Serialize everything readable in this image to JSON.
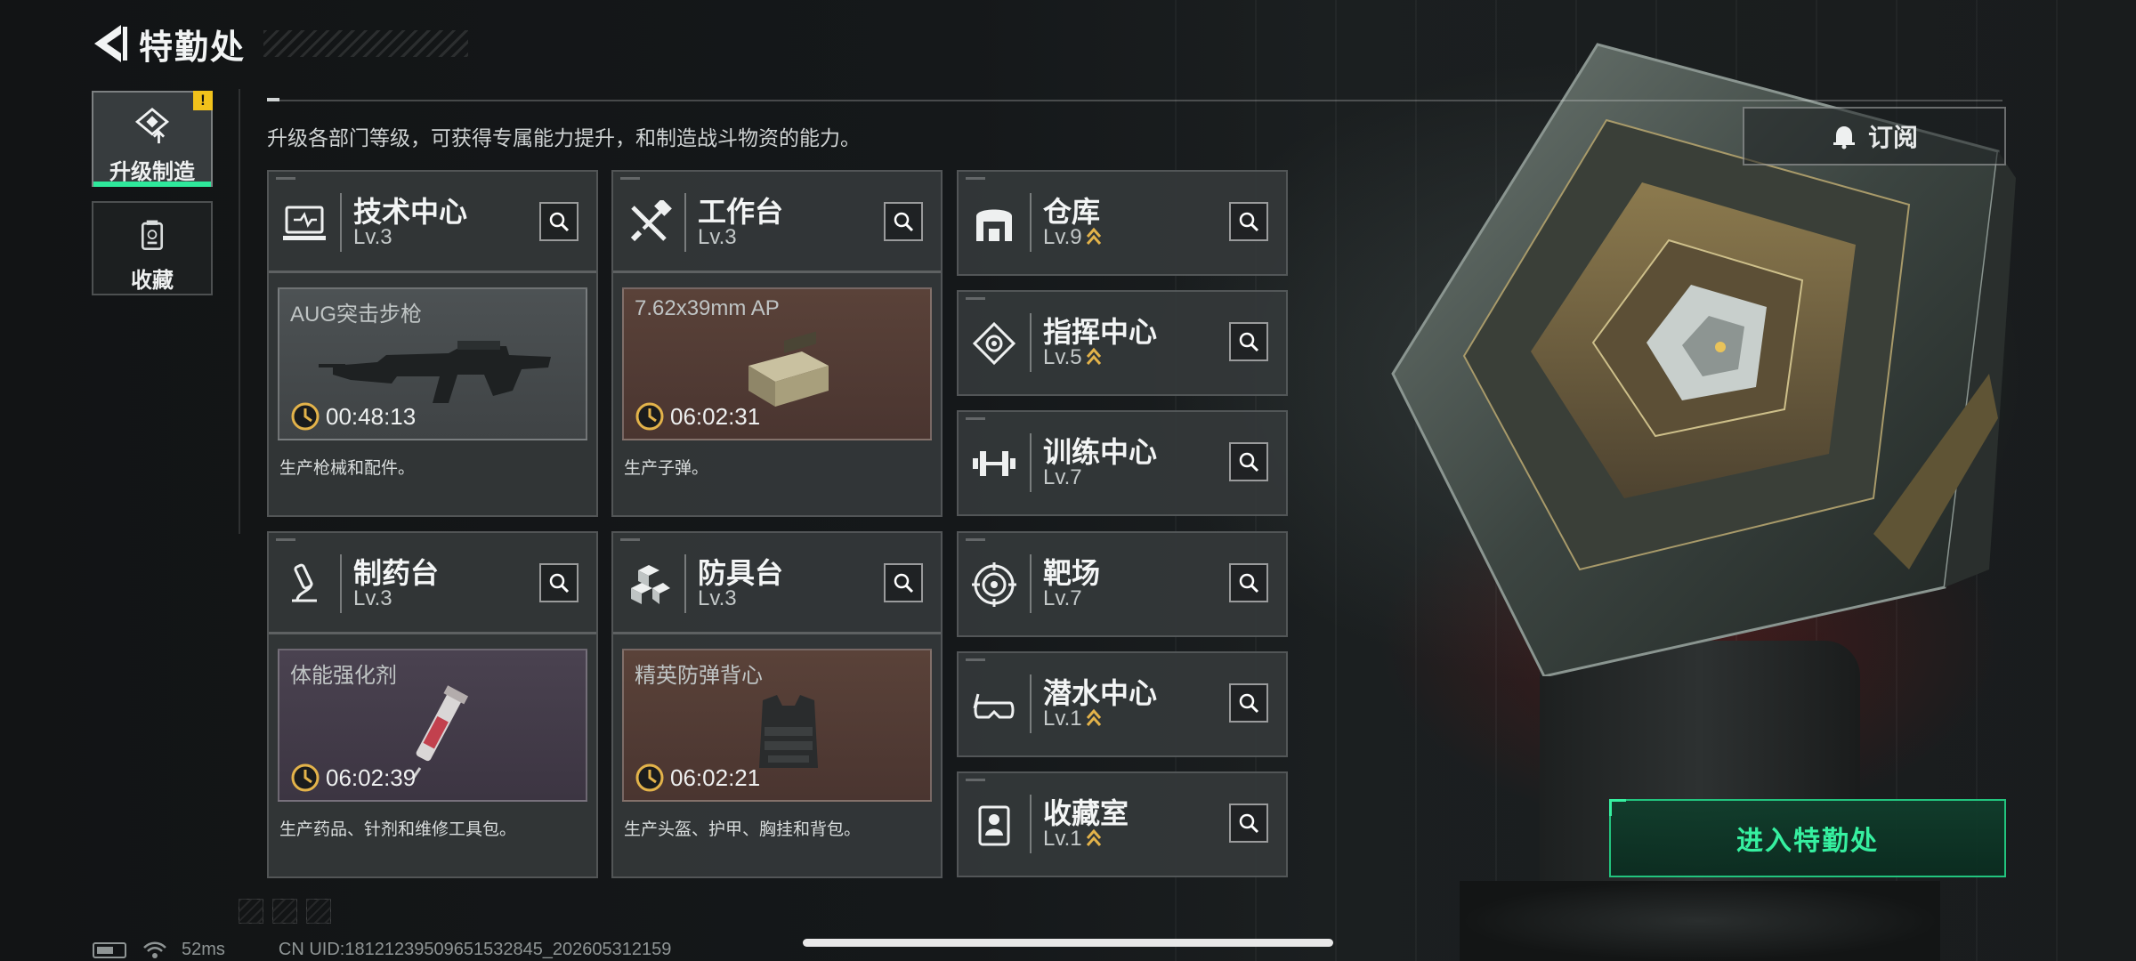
{
  "header": {
    "title": "特勤处"
  },
  "description": "升级各部门等级，可获得专属能力提升，和制造战斗物资的能力。",
  "nav": {
    "items": [
      {
        "label": "升级制造",
        "icon": "upgrade-craft-icon",
        "active": true,
        "alert": "!"
      },
      {
        "label": "收藏",
        "icon": "collection-icon",
        "active": false
      }
    ]
  },
  "departments": [
    {
      "name": "技术中心",
      "level": "Lv.3",
      "icon": "tech-center-icon",
      "production": {
        "item": "AUG突击步枪",
        "timer": "00:48:13",
        "theme": "gray",
        "image": "rifle-image"
      },
      "desc": "生产枪械和配件。"
    },
    {
      "name": "工作台",
      "level": "Lv.3",
      "icon": "workbench-icon",
      "production": {
        "item": "7.62x39mm AP",
        "timer": "06:02:31",
        "theme": "brown",
        "image": "ammo-box-image"
      },
      "desc": "生产子弹。"
    },
    {
      "name": "制药台",
      "level": "Lv.3",
      "icon": "pharmacy-icon",
      "production": {
        "item": "体能强化剂",
        "timer": "06:02:39",
        "theme": "purple",
        "image": "syringe-image"
      },
      "desc": "生产药品、针剂和维修工具包。"
    },
    {
      "name": "防具台",
      "level": "Lv.3",
      "icon": "armor-bench-icon",
      "production": {
        "item": "精英防弹背心",
        "timer": "06:02:21",
        "theme": "brown",
        "image": "vest-image"
      },
      "desc": "生产头盔、护甲、胸挂和背包。"
    },
    {
      "name": "仓库",
      "level": "Lv.9",
      "icon": "warehouse-icon",
      "upgradable": true
    },
    {
      "name": "指挥中心",
      "level": "Lv.5",
      "icon": "command-center-icon",
      "upgradable": true
    },
    {
      "name": "训练中心",
      "level": "Lv.7",
      "icon": "training-center-icon",
      "upgradable": false
    },
    {
      "name": "靶场",
      "level": "Lv.7",
      "icon": "shooting-range-icon",
      "upgradable": false
    },
    {
      "name": "潜水中心",
      "level": "Lv.1",
      "icon": "diving-center-icon",
      "upgradable": true
    },
    {
      "name": "收藏室",
      "level": "Lv.1",
      "icon": "collection-room-icon",
      "upgradable": true
    }
  ],
  "subscribe": {
    "label": "订阅",
    "icon": "bell-icon"
  },
  "enter_button": {
    "label": "进入特勤处"
  },
  "status": {
    "ping": "52ms",
    "uid": "CN UID:18121239509651532845_202605312159"
  },
  "colors": {
    "accent_green": "#36f0a0",
    "alert_yellow": "#f1c21b",
    "upgrade_arrow": "#e3b34a"
  }
}
